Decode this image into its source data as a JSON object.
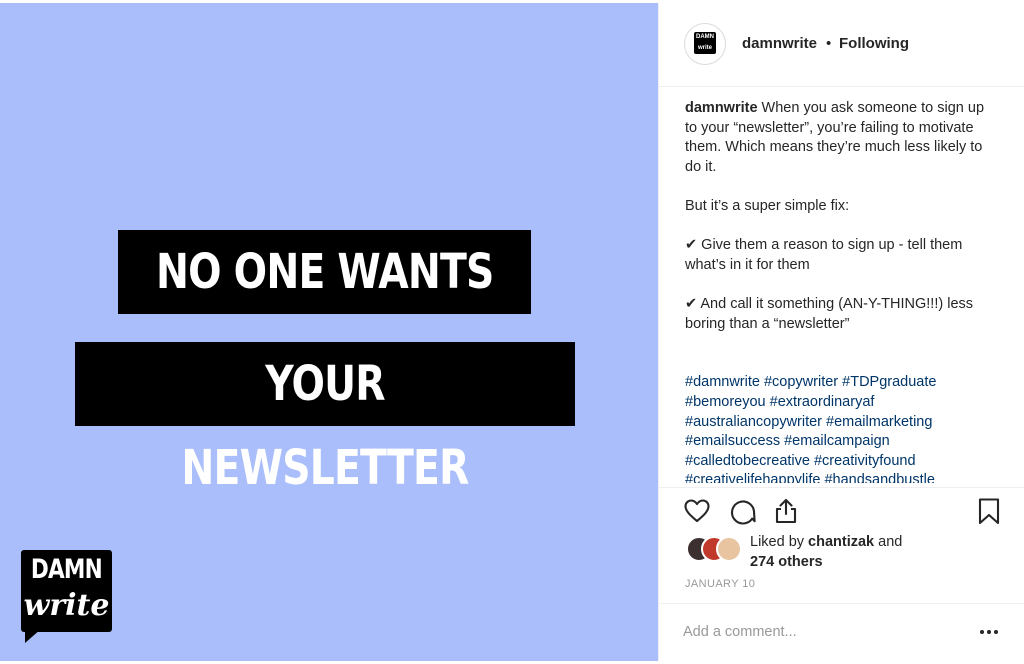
{
  "image": {
    "headline_line1": "NO ONE WANTS",
    "headline_line2": "YOUR NEWSLETTER",
    "background_color": "#a9befa",
    "logo": {
      "line1": "DAMN",
      "line2": "write"
    }
  },
  "header": {
    "avatar_text": "DAMN write",
    "username": "damnwrite",
    "separator": "•",
    "follow_status": "Following"
  },
  "caption": {
    "username": "damnwrite",
    "intro": "When you ask someone to sign up to your “newsletter”, you’re failing to motivate them. Which means they’re much less likely to do it.",
    "fix_line": "But it’s a super simple fix:",
    "tip1": "✔  Give them a reason to sign up - tell them what’s in it for them",
    "tip2": "✔  And call it something (AN-Y-THING!!!) less boring than a “newsletter”",
    "hashtags": "#damnwrite #copywriter #TDPgraduate #bemoreyou #extraordinaryaf #australiancopywriter #emailmarketing #emailsuccess #emailcampaign #calledtobecreative #creativityfound #creativelifehappylife #handsandbustle"
  },
  "actions": {
    "icons": [
      "heart-icon",
      "comment-icon",
      "share-icon",
      "bookmark-icon"
    ]
  },
  "likes": {
    "prefix": "Liked by ",
    "user": "chantizak",
    "suffix": " and",
    "others": "274 others"
  },
  "date": "JANUARY 10",
  "comment": {
    "placeholder": "Add a comment..."
  }
}
